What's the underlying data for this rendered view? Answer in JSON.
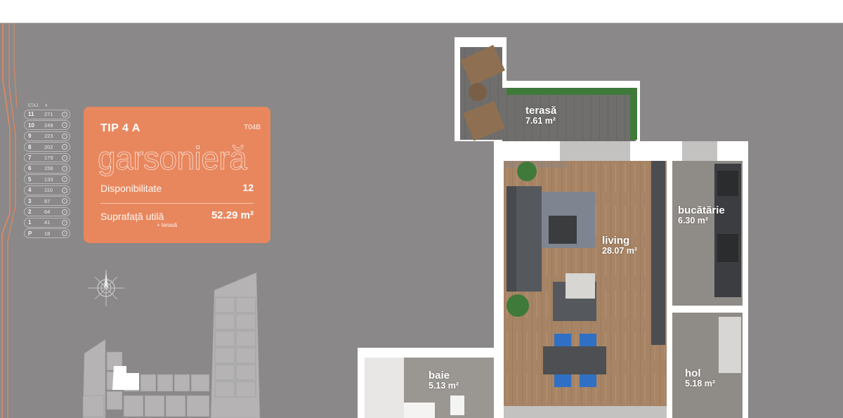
{
  "floors": {
    "header_floor": "ETAJ",
    "header_price": "#",
    "rows": [
      {
        "floor": "11",
        "value": "271"
      },
      {
        "floor": "10",
        "value": "249"
      },
      {
        "floor": "9",
        "value": "223"
      },
      {
        "floor": "8",
        "value": "202"
      },
      {
        "floor": "7",
        "value": "179"
      },
      {
        "floor": "6",
        "value": "156"
      },
      {
        "floor": "5",
        "value": "133"
      },
      {
        "floor": "4",
        "value": "110"
      },
      {
        "floor": "3",
        "value": "87"
      },
      {
        "floor": "2",
        "value": "64"
      },
      {
        "floor": "1",
        "value": "41"
      },
      {
        "floor": "P",
        "value": "18"
      }
    ],
    "arrow_glyph": "›"
  },
  "card": {
    "type": "TIP 4 A",
    "code": "T04B",
    "kind": "garsonieră",
    "availability_label": "Disponibilitate",
    "availability_value": "12",
    "area_label": "Suprafață utilă",
    "area_sublabel": "+ terasă",
    "area_value": "52.29 m²"
  },
  "rooms": [
    {
      "name": "terasă",
      "area": "7.61 m²"
    },
    {
      "name": "bucătărie",
      "area": "6.30 m²"
    },
    {
      "name": "living",
      "area": "28.07 m²"
    },
    {
      "name": "baie",
      "area": "5.13 m²"
    },
    {
      "name": "hol",
      "area": "5.18 m²"
    }
  ],
  "colors": {
    "background": "#8a8888",
    "accent": "#e8875e",
    "wall": "#ffffff",
    "floor_wood": "#a78465",
    "floor_tile": "#8f8b86",
    "sofa": "#55595e",
    "chairs": "#2f6fc4"
  },
  "icons": [
    "compass-icon",
    "chevron-right-icon"
  ]
}
